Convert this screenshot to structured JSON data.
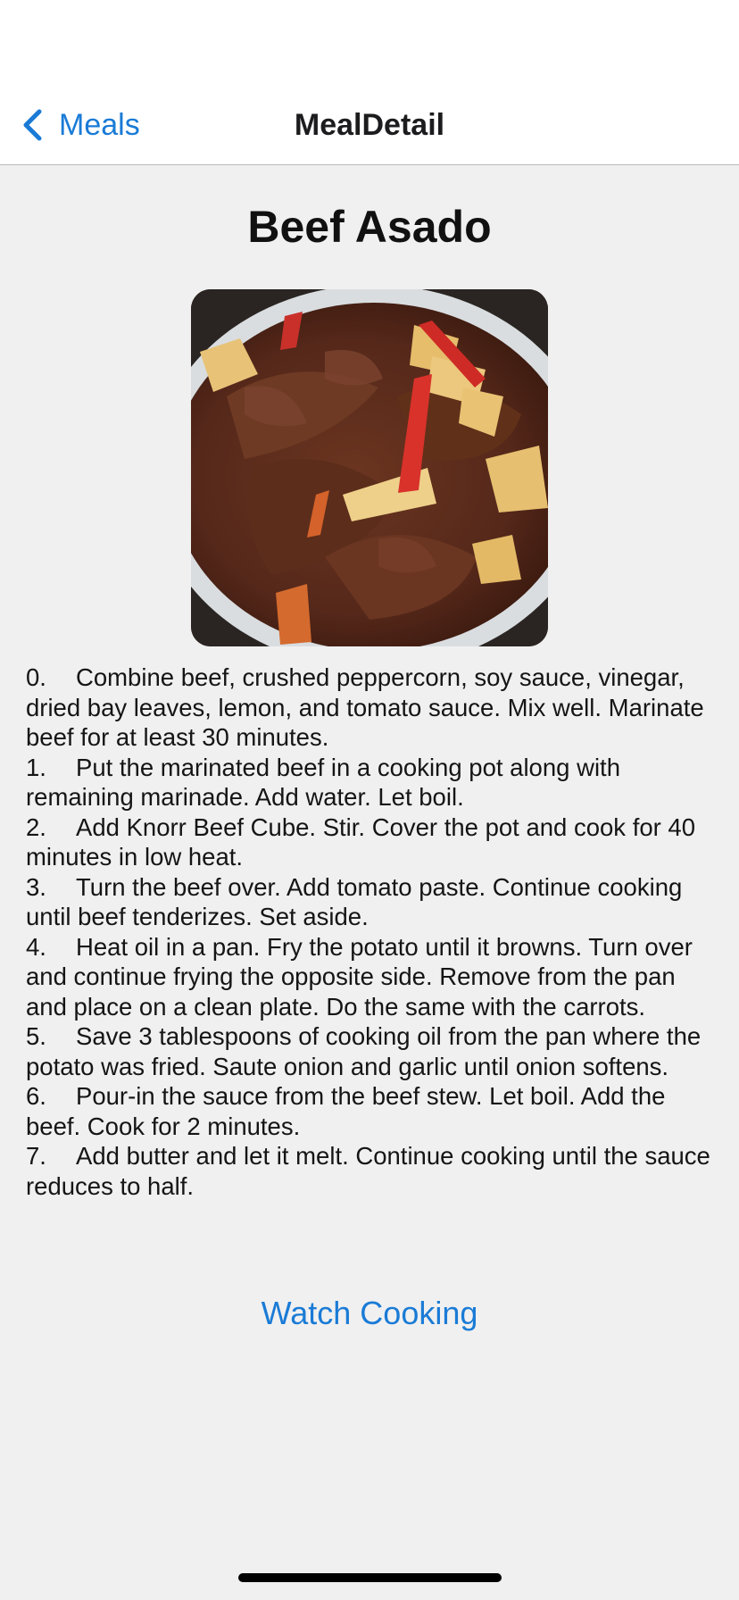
{
  "colors": {
    "accent": "#1a7bd6",
    "nav_background": "#ffffff",
    "content_background": "#f0f0f0"
  },
  "nav": {
    "back_label": "Meals",
    "back_icon": "chevron-left-icon",
    "title": "MealDetail"
  },
  "meal": {
    "title": "Beef Asado",
    "image_alt": "Beef Asado photo"
  },
  "steps": [
    {
      "num": "0.",
      "text": "Combine beef, crushed peppercorn, soy sauce, vinegar, dried bay leaves, lemon, and tomato sauce. Mix well. Marinate beef for at least 30 minutes."
    },
    {
      "num": "1.",
      "text": "Put the marinated beef in a cooking pot along with remaining marinade. Add water. Let boil."
    },
    {
      "num": "2.",
      "text": "Add Knorr Beef Cube. Stir. Cover the pot and cook for 40 minutes in low heat."
    },
    {
      "num": "3.",
      "text": "Turn the beef over. Add tomato paste. Continue cooking until beef tenderizes. Set aside."
    },
    {
      "num": "4.",
      "text": "Heat oil in a pan. Fry the potato until it browns. Turn over and continue frying the opposite side. Remove from the pan and place on a clean plate. Do the same with the carrots."
    },
    {
      "num": "5.",
      "text": "Save 3 tablespoons of cooking oil from the pan where the potato was fried. Saute onion and garlic until onion softens."
    },
    {
      "num": "6.",
      "text": "Pour-in the sauce from the beef stew. Let boil. Add the beef. Cook for 2 minutes."
    },
    {
      "num": "7.",
      "text": "Add butter and let it melt. Continue cooking until the sauce reduces to half."
    }
  ],
  "actions": {
    "watch_label": "Watch Cooking"
  }
}
